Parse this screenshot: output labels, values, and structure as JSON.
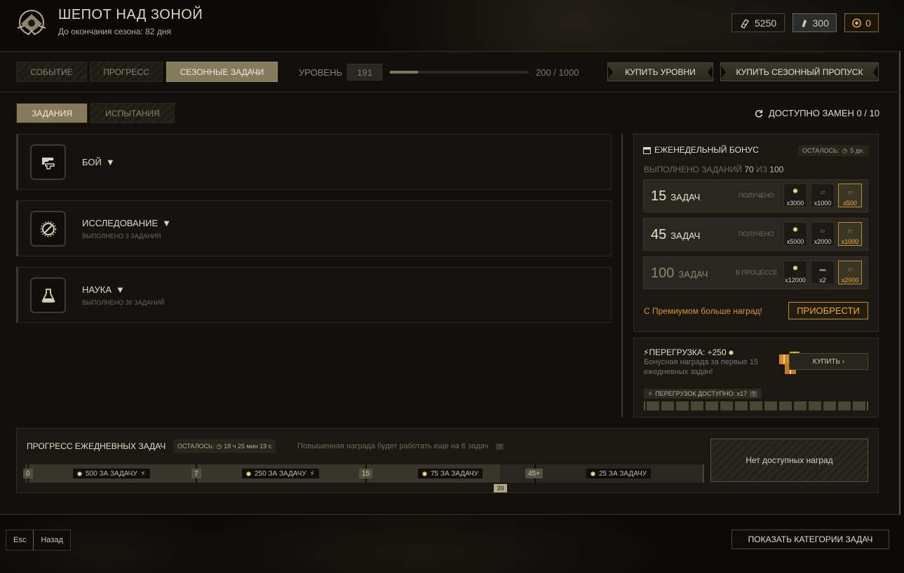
{
  "header": {
    "title": "ШЕПОТ НАД ЗОНОЙ",
    "subtitle": "До окончания сезона: 82 дня"
  },
  "currencies": [
    {
      "icon": "shard-icon",
      "value": "5250"
    },
    {
      "icon": "ticket-icon",
      "value": "300"
    },
    {
      "icon": "coin-icon",
      "value": "0"
    }
  ],
  "tabs": [
    "СОБЫТИЕ",
    "ПРОГРЕСС",
    "СЕЗОННЫЕ ЗАДАЧИ"
  ],
  "level": {
    "label": "УРОВЕНЬ",
    "value": "191",
    "progress_text": "200 / 1000",
    "progress": 0.2
  },
  "buttons": {
    "buy_levels": "КУПИТЬ УРОВНИ",
    "buy_pass": "КУПИТЬ СЕЗОННЫЙ ПРОПУСК"
  },
  "subtabs": [
    "ЗАДАНИЯ",
    "ИСПЫТАНИЯ"
  ],
  "swaps": "ДОСТУПНО ЗАМЕН 0 / 10",
  "categories": [
    {
      "name": "БОЙ",
      "sub": "",
      "icon": "gun-icon"
    },
    {
      "name": "ИССЛЕДОВАНИЕ",
      "sub": "ВЫПОЛНЕНО 3 ЗАДАНИЯ",
      "icon": "compass-icon"
    },
    {
      "name": "НАУКА",
      "sub": "ВЫПОЛНЕНО 36 ЗАДАНИЙ",
      "icon": "flask-icon"
    }
  ],
  "weekly": {
    "title": "ЕЖЕНЕДЕЛЬНЫЙ БОНУС",
    "left_label": "ОСТАЛОСЬ:",
    "left_value": "5 дн.",
    "done_prefix": "ВЫПОЛНЕНО ЗАДАНИЙ",
    "done": "70",
    "of": "ИЗ",
    "total": "100",
    "tiers": [
      {
        "num": "15",
        "unit": "ЗАДАЧ",
        "status": "ПОЛУЧЕНО",
        "rewards": [
          "x3000",
          "x1000",
          "x500"
        ]
      },
      {
        "num": "45",
        "unit": "ЗАДАЧ",
        "status": "ПОЛУЧЕНО",
        "rewards": [
          "x5000",
          "x2000",
          "x1000"
        ]
      },
      {
        "num": "100",
        "unit": "ЗАДАЧ",
        "status": "В ПРОЦЕССЕ",
        "rewards": [
          "x12000",
          "x2",
          "x2000"
        ]
      }
    ],
    "premium_text": "С Премиумом больше наград!",
    "premium_btn": "ПРИОБРЕСТИ"
  },
  "overload": {
    "title": "ПЕРЕГРУЗКА: +250",
    "desc": "Бонусная награда за первые 15 ежедневных задач!",
    "buy": "КУПИТЬ",
    "available": "ПЕРЕГРУЗОК ДОСТУПНО: x17",
    "help": "?",
    "cells": 15
  },
  "daily": {
    "title": "ПРОГРЕСС ЕЖЕДНЕВНЫХ ЗАДАЧ",
    "left": "ОСТАЛОСЬ:",
    "left_value": "18 ч 25 мин 19 с",
    "note": "Повышенная награда будет работать еще на 6 задач",
    "help": "?",
    "ticks": [
      "0",
      "7",
      "15",
      "45+"
    ],
    "segments": [
      "500 ЗА ЗАДАЧУ",
      "250 ЗА ЗАДАЧУ",
      "75 ЗА ЗАДАЧУ",
      "25 ЗА ЗАДАЧУ"
    ],
    "current": "39",
    "no_rewards": "Нет доступных наград"
  },
  "footer": {
    "esc": "Esc",
    "back": "Назад",
    "show_categories": "ПОКАЗАТЬ КАТЕГОРИИ ЗАДАЧ"
  }
}
